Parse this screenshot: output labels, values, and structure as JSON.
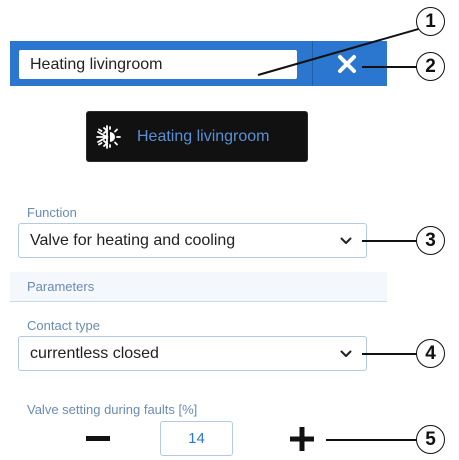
{
  "header": {
    "name_value": "Heating livingroom",
    "close_icon": "close-x-icon"
  },
  "preview": {
    "icon": "heating-cooling-icon",
    "label": "Heating livingroom"
  },
  "function": {
    "label": "Function",
    "selected": "Valve for heating and cooling"
  },
  "parameters": {
    "title": "Parameters"
  },
  "contact_type": {
    "label": "Contact type",
    "selected": "currentless closed"
  },
  "valve_fault": {
    "label": "Valve setting during faults [%]",
    "value": "14",
    "minus_icon": "minus-icon",
    "plus_icon": "plus-icon"
  },
  "callouts": [
    "1",
    "2",
    "3",
    "4",
    "5"
  ],
  "colors": {
    "header_blue": "#2b77cf",
    "label_blue": "#6a8bb3",
    "tile_black": "#111111"
  }
}
